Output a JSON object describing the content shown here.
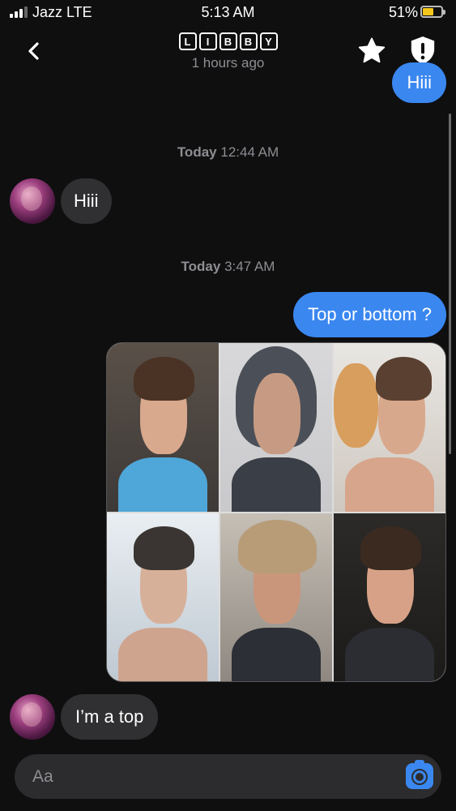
{
  "status_bar": {
    "carrier": "Jazz LTE",
    "time": "5:13 AM",
    "battery_percent": "51%",
    "battery_level": 0.51,
    "signal_bars": 3
  },
  "header": {
    "title_letters": [
      "L",
      "I",
      "B",
      "B",
      "Y"
    ],
    "last_seen": "1 hours ago",
    "back_icon": "chevron-left-icon",
    "star_icon": "star-icon",
    "shield_icon": "shield-alert-icon"
  },
  "messages": [
    {
      "type": "outgoing",
      "text": "Hiii"
    },
    {
      "type": "timestamp",
      "day": "Today",
      "time": "12:44 AM"
    },
    {
      "type": "incoming",
      "text": "Hiii"
    },
    {
      "type": "timestamp",
      "day": "Today",
      "time": "3:47 AM"
    },
    {
      "type": "outgoing",
      "text": "Top or bottom ?"
    },
    {
      "type": "outgoing_image",
      "photos": 6
    },
    {
      "type": "incoming",
      "text": "I’m a top"
    }
  ],
  "ts1": {
    "day": "Today",
    "time": "12:44 AM"
  },
  "ts2": {
    "day": "Today",
    "time": "3:47 AM"
  },
  "msg": {
    "out1": "Hiii",
    "in1": "Hiii",
    "out2": "Top or bottom ?",
    "in2": "I’m a top"
  },
  "composer": {
    "placeholder": "Aa",
    "camera_icon": "camera-icon"
  },
  "colors": {
    "background": "#0f0f10",
    "outgoing_bubble": "#3a87f0",
    "incoming_bubble": "#303032",
    "battery_fill": "#f3c71b"
  }
}
